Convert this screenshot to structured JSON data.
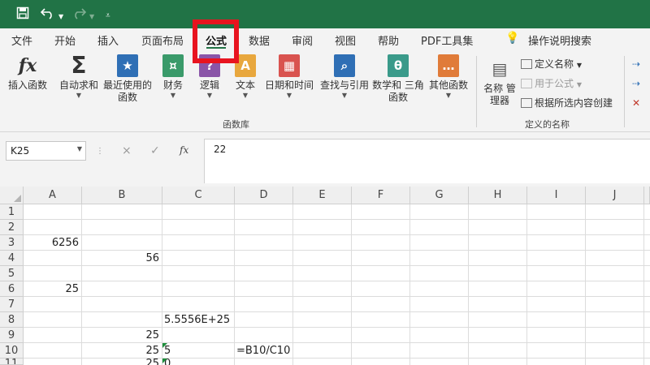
{
  "colors": {
    "titlebar": "#217346",
    "highlight": "#e8141f",
    "active_tab_underline": "#217346"
  },
  "quick_access": {
    "save_icon": "save-icon",
    "undo_icon": "undo-icon",
    "redo_icon": "redo-icon",
    "customize_icon": "customize-quick-access-icon"
  },
  "tabs": [
    {
      "label": "文件"
    },
    {
      "label": "开始"
    },
    {
      "label": "插入"
    },
    {
      "label": "页面布局"
    },
    {
      "label": "公式"
    },
    {
      "label": "数据"
    },
    {
      "label": "审阅"
    },
    {
      "label": "视图"
    },
    {
      "label": "帮助"
    },
    {
      "label": "PDF工具集"
    }
  ],
  "search": {
    "icon": "lightbulb-icon",
    "label": "操作说明搜索"
  },
  "ribbon": {
    "insert_function": {
      "icon_text": "fx",
      "label": "插入函数"
    },
    "autosum": {
      "icon_text": "Σ",
      "label": "自动求和"
    },
    "recent": {
      "label_line1": "最近使用的",
      "label_line2": "函数"
    },
    "financial": {
      "label": "财务"
    },
    "logical": {
      "label": "逻辑"
    },
    "text": {
      "label": "文本"
    },
    "datetime": {
      "label": "日期和时间"
    },
    "lookup": {
      "label": "查找与引用"
    },
    "math": {
      "icon_text": "θ",
      "label_line1": "数学和",
      "label_line2": "三角函数"
    },
    "more": {
      "label": "其他函数"
    },
    "library_group_label": "函数库",
    "name_manager": {
      "label_line1": "名称",
      "label_line2": "管理器"
    },
    "define_name": {
      "label": "定义名称"
    },
    "use_in_formula": {
      "label": "用于公式"
    },
    "create_from_selection": {
      "label": "根据所选内容创建"
    },
    "defined_names_group_label": "定义的名称"
  },
  "formula_bar": {
    "name_box": "K25",
    "cancel_icon": "×",
    "enter_icon": "✓",
    "fx_icon": "fx",
    "value": "22"
  },
  "columns": [
    "A",
    "B",
    "C",
    "D",
    "E",
    "F",
    "G",
    "H",
    "I",
    "J"
  ],
  "rows": [
    "1",
    "2",
    "3",
    "4",
    "5",
    "6",
    "7",
    "8",
    "9",
    "10",
    "11"
  ],
  "cells": {
    "A3": "6256",
    "B4": "56",
    "A6": "25",
    "C8": "5.5556E+25",
    "B9": "25",
    "B10": "25",
    "C10": "5",
    "D10": "=B10/C10",
    "B11": "25",
    "C11": "0"
  }
}
